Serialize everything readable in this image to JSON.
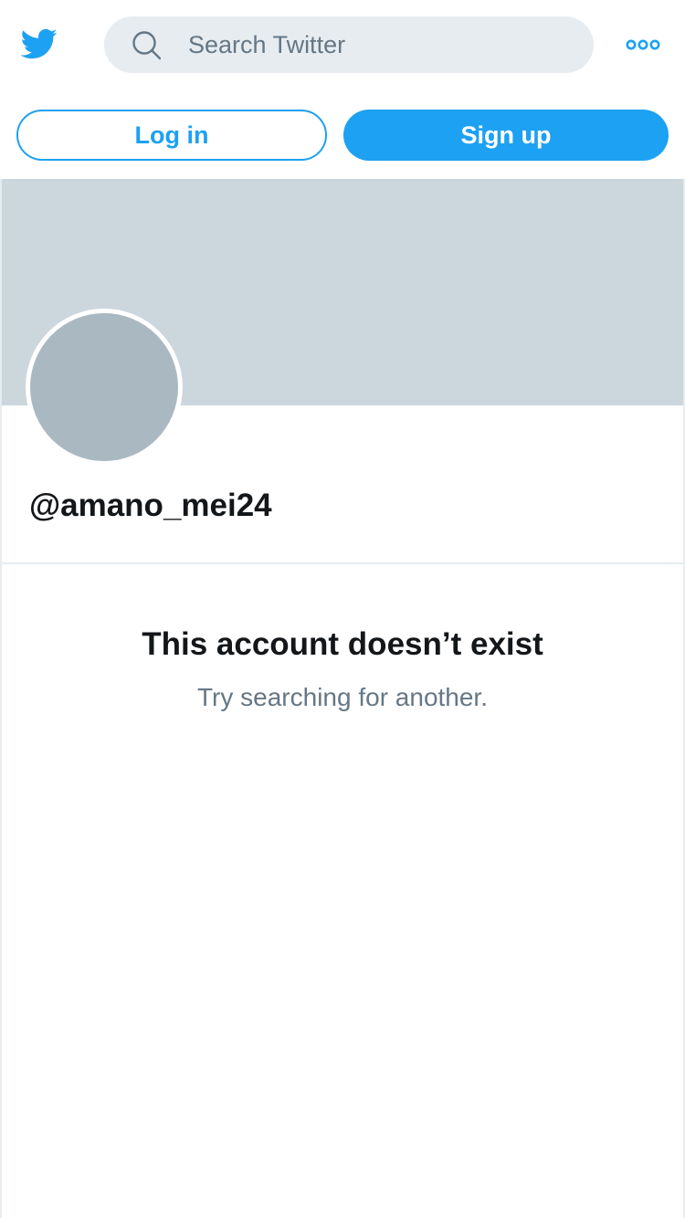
{
  "app": "Twitter",
  "colors": {
    "brand": "#1da1f2",
    "search_bg": "#e6ecf0",
    "banner": "#ccd6dd",
    "avatar": "#aab8c2",
    "text_primary": "#14171a",
    "text_secondary": "#657786"
  },
  "header": {
    "logo_icon": "twitter-bird-icon",
    "search": {
      "icon": "search-icon",
      "value": "",
      "placeholder": "Search Twitter"
    },
    "more_icon": "more-options-icon"
  },
  "auth": {
    "login_label": "Log in",
    "signup_label": "Sign up"
  },
  "profile": {
    "handle": "@amano_mei24"
  },
  "empty_state": {
    "title": "This account doesn’t exist",
    "subtitle": "Try searching for another."
  }
}
